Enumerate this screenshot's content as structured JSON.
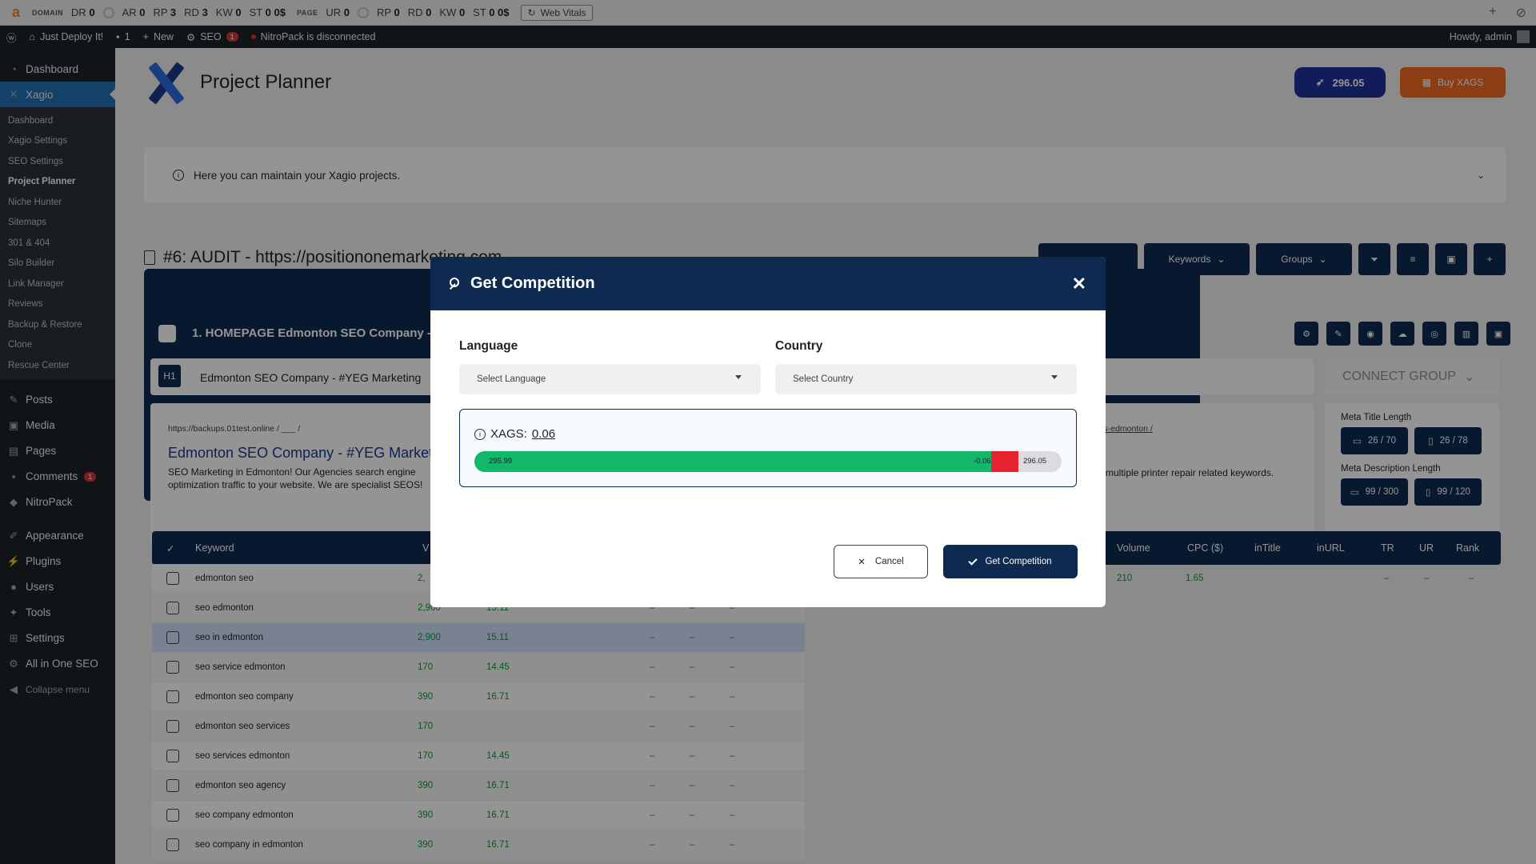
{
  "seobar": {
    "domain_label": "DOMAIN",
    "page_label": "PAGE",
    "domain_metrics": [
      {
        "k": "DR",
        "v": "0"
      },
      {
        "k": "AR",
        "v": "0"
      },
      {
        "k": "RP",
        "v": "3"
      },
      {
        "k": "RD",
        "v": "3"
      },
      {
        "k": "KW",
        "v": "0"
      },
      {
        "k": "ST",
        "v": "0 0$"
      }
    ],
    "page_metrics": [
      {
        "k": "UR",
        "v": "0"
      },
      {
        "k": "RP",
        "v": "0"
      },
      {
        "k": "RD",
        "v": "0"
      },
      {
        "k": "KW",
        "v": "0"
      },
      {
        "k": "ST",
        "v": "0 0$"
      }
    ],
    "web_vitals": "Web Vitals"
  },
  "adminbar": {
    "site": "Just Deploy It!",
    "comments": "1",
    "new": "New",
    "seo": "SEO",
    "seo_badge": "1",
    "nitropack": "NitroPack is disconnected",
    "howdy": "Howdy, admin"
  },
  "sidebar": {
    "top": [
      {
        "label": "Dashboard",
        "icon": "dashboard-icon"
      }
    ],
    "active": "Xagio",
    "submenu": [
      "Dashboard",
      "Xagio Settings",
      "SEO Settings",
      "Project Planner",
      "Niche Hunter",
      "Sitemaps",
      "301 & 404",
      "Silo Builder",
      "Link Manager",
      "Reviews",
      "Backup & Restore",
      "Clone",
      "Rescue Center"
    ],
    "current_sub": "Project Planner",
    "group2": [
      {
        "label": "Posts"
      },
      {
        "label": "Media"
      },
      {
        "label": "Pages"
      },
      {
        "label": "Comments",
        "badge": "1"
      },
      {
        "label": "NitroPack"
      }
    ],
    "group3": [
      {
        "label": "Appearance"
      },
      {
        "label": "Plugins"
      },
      {
        "label": "Users"
      },
      {
        "label": "Tools"
      },
      {
        "label": "Settings"
      },
      {
        "label": "All in One SEO"
      },
      {
        "label": "Collapse menu"
      }
    ]
  },
  "header": {
    "title": "Project Planner",
    "credits": "296.05",
    "buy": "Buy XAGS"
  },
  "info": {
    "text": "Here you can maintain your Xagio projects."
  },
  "project": {
    "title": "#6: AUDIT - https://positiononemarketing.com",
    "toolbar": {
      "keywords": "Keywords",
      "groups": "Groups"
    }
  },
  "group": {
    "title": "1. HOMEPAGE Edmonton SEO Company - #YEG Marketing",
    "h1_tag": "H1",
    "h1_text": "Edmonton SEO Company - #YEG Marketing",
    "connect": "CONNECT GROUP",
    "serp_url": "https://backups.01test.online / ___ /",
    "serp_title": "Edmonton SEO Company - #YEG Marketing",
    "serp_desc": "SEO Marketing in Edmonton! Our Agencies search engine optimization traffic to your website. We are specialist SEOS!",
    "serp_url2": "rs-edmonton /",
    "serp_desc2": "multiple printer repair related keywords.",
    "meta_title_label": "Meta Title Length",
    "meta_title_desktop": "26 / 70",
    "meta_title_mobile": "26 / 78",
    "meta_desc_label": "Meta Description Length",
    "meta_desc_desktop": "99 / 300",
    "meta_desc_mobile": "99 / 120"
  },
  "table": {
    "headers": {
      "keyword": "Keyword",
      "vol": "V",
      "volume": "Volume",
      "cpc": "CPC ($)",
      "intitle": "inTitle",
      "inurl": "inURL",
      "tr": "TR",
      "ur": "UR",
      "rank": "Rank"
    },
    "rows": [
      {
        "kw": "edmonton seo",
        "vol": "2,",
        "cpc": ""
      },
      {
        "kw": "seo edmonton",
        "vol": "2,900",
        "cpc": "15.11"
      },
      {
        "kw": "seo in edmonton",
        "vol": "2,900",
        "cpc": "15.11"
      },
      {
        "kw": "seo service edmonton",
        "vol": "170",
        "cpc": "14.45"
      },
      {
        "kw": "edmonton seo company",
        "vol": "390",
        "cpc": "16.71"
      },
      {
        "kw": "edmonton seo services",
        "vol": "170",
        "cpc": ""
      },
      {
        "kw": "seo services edmonton",
        "vol": "170",
        "cpc": "14.45"
      },
      {
        "kw": "edmonton seo agency",
        "vol": "390",
        "cpc": "16.71"
      },
      {
        "kw": "seo company edmonton",
        "vol": "390",
        "cpc": "16.71"
      },
      {
        "kw": "seo company in edmonton",
        "vol": "390",
        "cpc": "16.71"
      }
    ],
    "dash": "–",
    "row2": {
      "volume": "210",
      "cpc": "1.65"
    }
  },
  "modal": {
    "title": "Get Competition",
    "language_label": "Language",
    "language_placeholder": "Select Language",
    "country_label": "Country",
    "country_placeholder": "Select Country",
    "xags_label": "XAGS:",
    "xags_cost": "0.06",
    "balance_after": "295.99",
    "cost_label": "-0.06",
    "balance_total": "296.05",
    "balance_after_value": 295.99,
    "balance_total_value": 296.05,
    "cost_value": 0.06,
    "cancel": "Cancel",
    "submit": "Get Competition"
  },
  "colors": {
    "navy": "#0f2a50",
    "green": "#12b76a",
    "red": "#e5232e",
    "orange": "#f26a21"
  }
}
